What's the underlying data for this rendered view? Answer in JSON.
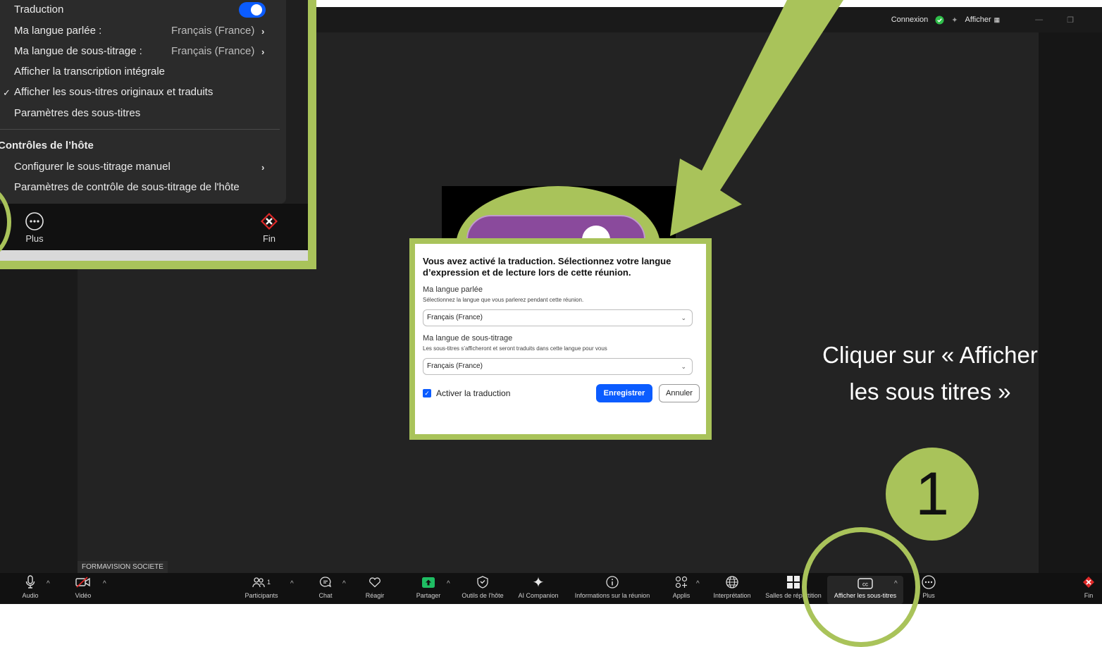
{
  "titlebar": {
    "connexion": "Connexion",
    "afficher": "Afficher"
  },
  "participant_name": "FORMAVISION SOCIETE",
  "toolbar": {
    "audio": "Audio",
    "video": "Vidéo",
    "participants": "Participants",
    "participants_count": "1",
    "chat": "Chat",
    "react": "Réagir",
    "share": "Partager",
    "host_tools": "Outils de l'hôte",
    "ai_companion": "AI Companion",
    "meeting_info": "Informations sur la réunion",
    "apps": "Applis",
    "interpretation": "Interprétation",
    "breakout": "Salles de répartition",
    "captions": "Afficher les sous-titres",
    "more": "Plus",
    "end": "Fin"
  },
  "dialog": {
    "title": "Vous avez activé la traduction. Sélectionnez votre langue d’expression et de lecture lors de cette réunion.",
    "spoken_label": "Ma langue parlée",
    "spoken_help": "Sélectionnez la langue que vous parlerez pendant cette réunion.",
    "spoken_value": "Français (France)",
    "caption_label": "Ma langue de sous-titrage",
    "caption_help": "Les sous-titres s’afficheront et seront traduits dans cette langue pour vous",
    "caption_value": "Français (France)",
    "enable_translation": "Activer la traduction",
    "enable_translation_checked": true,
    "save": "Enregistrer",
    "cancel": "Annuler"
  },
  "inset_menu": {
    "translation": "Traduction",
    "translation_on": true,
    "spoken_lang_label": "Ma langue parlée :",
    "spoken_lang_value": "Français (France)",
    "caption_lang_label": "Ma langue de sous-titrage :",
    "caption_lang_value": "Français (France)",
    "full_transcript": "Afficher la transcription intégrale",
    "show_original_translated": "Afficher les sous-titres originaux et traduits",
    "caption_settings": "Paramètres des sous-titres",
    "host_controls_header": "Contrôles de l’hôte",
    "configure_manual": "Configurer le sous-titrage manuel",
    "host_caption_settings": "Paramètres de contrôle de sous-titrage de l'hôte",
    "more": "Plus",
    "end": "Fin"
  },
  "annotation": {
    "hint": "Cliquer sur « Afficher les sous titres »",
    "step": "1"
  },
  "colors": {
    "accent_green": "#a9c35a",
    "zoom_blue": "#0b5cff",
    "end_red": "#e02828"
  }
}
